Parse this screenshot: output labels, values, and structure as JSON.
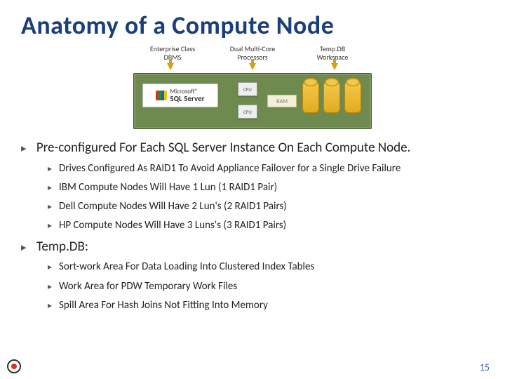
{
  "title": "Anatomy of a Compute Node",
  "diagram": {
    "labels": {
      "dbms": "Enterprise Class\nDBMS",
      "cpu": "Dual Multi-Core\nProcessors",
      "tempdb": "Temp.DB\nWorkspace"
    },
    "sqlserver_small": "Microsoft®",
    "sqlserver_big": "SQL Server",
    "cpu_label": "CPU",
    "ram_label": "RAM"
  },
  "bullets": [
    {
      "text": "Pre-configured For Each SQL Server Instance On Each Compute Node.",
      "children": [
        "Drives Configured As RAID1 To Avoid Appliance Failover for a Single Drive Failure",
        "IBM Compute Nodes Will Have 1 Lun (1 RAID1 Pair)",
        "Dell Compute Nodes Will Have 2 Lun's (2 RAID1 Pairs)",
        "HP Compute Nodes Will Have 3 Luns's (3 RAID1 Pairs)"
      ]
    },
    {
      "text": "Temp.DB:",
      "children": [
        "Sort-work Area For Data Loading Into Clustered Index Tables",
        "Work Area for PDW Temporary Work Files",
        "Spill Area For Hash Joins Not Fitting Into Memory"
      ]
    }
  ],
  "page_number": "15"
}
